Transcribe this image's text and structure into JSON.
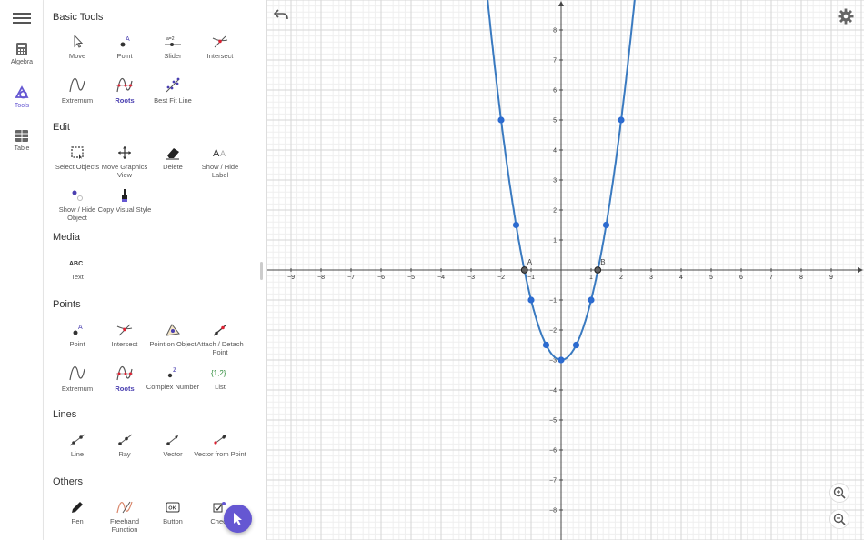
{
  "rail": {
    "items": [
      {
        "label": "Algebra"
      },
      {
        "label": "Tools"
      },
      {
        "label": "Table"
      }
    ]
  },
  "tools_panel": {
    "sections": [
      {
        "title": "Basic Tools",
        "tools": [
          "Move",
          "Point",
          "Slider",
          "Intersect",
          "Extremum",
          "Roots",
          "Best Fit Line"
        ]
      },
      {
        "title": "Edit",
        "tools": [
          "Select Objects",
          "Move Graphics View",
          "Delete",
          "Show / Hide Label",
          "Show / Hide Object",
          "Copy Visual Style"
        ]
      },
      {
        "title": "Media",
        "tools": [
          "Text"
        ]
      },
      {
        "title": "Points",
        "tools": [
          "Point",
          "Intersect",
          "Point on Object",
          "Attach / Detach Point",
          "Extremum",
          "Roots",
          "Complex Number",
          "List"
        ]
      },
      {
        "title": "Lines",
        "tools": [
          "Line",
          "Ray",
          "Vector",
          "Vector from Point"
        ]
      },
      {
        "title": "Others",
        "tools": [
          "Pen",
          "Freehand Function",
          "Button",
          "Check"
        ]
      }
    ],
    "icon_text": {
      "slider": "a=2",
      "text": "ABC",
      "list": "{1,2}",
      "button": "OK",
      "point": "A",
      "complex": "z"
    }
  },
  "graph": {
    "x_ticks": [
      "−9",
      "−8",
      "−7",
      "−6",
      "−5",
      "−4",
      "−3",
      "−2",
      "−1",
      "1",
      "2",
      "3",
      "4",
      "5",
      "6",
      "7",
      "8",
      "9"
    ],
    "x_tick_values": [
      -9,
      -8,
      -7,
      -6,
      -5,
      -4,
      -3,
      -2,
      -1,
      1,
      2,
      3,
      4,
      5,
      6,
      7,
      8,
      9
    ],
    "y_ticks": [
      "8",
      "7",
      "6",
      "5",
      "4",
      "3",
      "2",
      "1",
      "−1",
      "−2",
      "−3",
      "−4",
      "−5",
      "−6",
      "−7",
      "−8"
    ],
    "y_tick_values": [
      8,
      7,
      6,
      5,
      4,
      3,
      2,
      1,
      -1,
      -2,
      -3,
      -4,
      -5,
      -6,
      -7,
      -8
    ],
    "function": {
      "a": 2,
      "b": 0,
      "c": -3,
      "color": "#3a7ac0"
    },
    "points": [
      {
        "x": -2,
        "y": 5
      },
      {
        "x": -1.5,
        "y": 1.5
      },
      {
        "x": -1,
        "y": -1
      },
      {
        "x": -0.5,
        "y": -2.5
      },
      {
        "x": 0,
        "y": -3
      },
      {
        "x": 0.5,
        "y": -2.5
      },
      {
        "x": 1,
        "y": -1
      },
      {
        "x": 1.5,
        "y": 1.5
      },
      {
        "x": 2,
        "y": 5
      }
    ],
    "roots": [
      {
        "label": "A",
        "x": -1.22,
        "y": 0
      },
      {
        "label": "B",
        "x": 1.22,
        "y": 0
      }
    ],
    "accent": "#6557d2",
    "point_color": "#2c6bd0",
    "root_color": "#606060"
  }
}
